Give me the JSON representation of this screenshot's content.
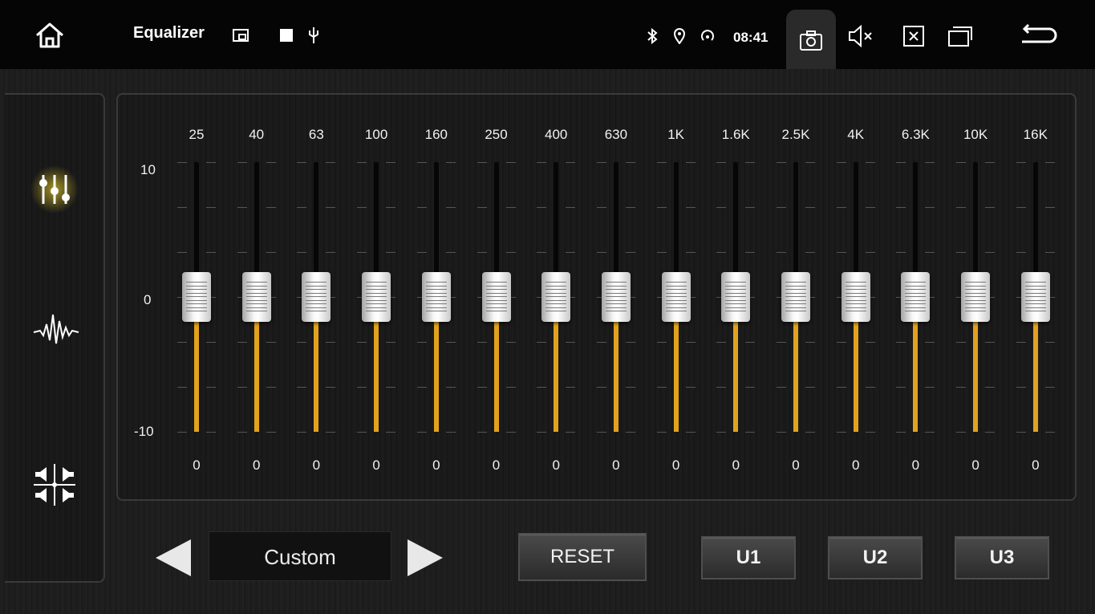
{
  "app": {
    "title": "Equalizer",
    "time": "08:41"
  },
  "topbar_icons": {
    "left": [
      "home-icon"
    ],
    "notifications": [
      "screen-mirror-icon",
      "square-icon",
      "usb-icon"
    ],
    "status": [
      "bluetooth-icon",
      "location-icon",
      "hotspot-icon"
    ],
    "right": [
      "camera-icon",
      "mute-icon",
      "close-app-icon",
      "recent-apps-icon",
      "back-icon"
    ]
  },
  "side_tabs": [
    "equalizer-sliders-icon",
    "sound-wave-icon",
    "balance-fader-icon"
  ],
  "eq": {
    "scale_top": "10",
    "scale_mid": "0",
    "scale_bottom": "-10",
    "range": [
      -10,
      10
    ],
    "bands": [
      {
        "freq": "25",
        "value": "0"
      },
      {
        "freq": "40",
        "value": "0"
      },
      {
        "freq": "63",
        "value": "0"
      },
      {
        "freq": "100",
        "value": "0"
      },
      {
        "freq": "160",
        "value": "0"
      },
      {
        "freq": "250",
        "value": "0"
      },
      {
        "freq": "400",
        "value": "0"
      },
      {
        "freq": "630",
        "value": "0"
      },
      {
        "freq": "1K",
        "value": "0"
      },
      {
        "freq": "1.6K",
        "value": "0"
      },
      {
        "freq": "2.5K",
        "value": "0"
      },
      {
        "freq": "4K",
        "value": "0"
      },
      {
        "freq": "6.3K",
        "value": "0"
      },
      {
        "freq": "10K",
        "value": "0"
      },
      {
        "freq": "16K",
        "value": "0"
      }
    ]
  },
  "controls": {
    "preset": "Custom",
    "reset": "RESET",
    "user_presets": [
      "U1",
      "U2",
      "U3"
    ]
  },
  "colors": {
    "accent": "#e3a21d",
    "active_glow": "#b59a18"
  }
}
